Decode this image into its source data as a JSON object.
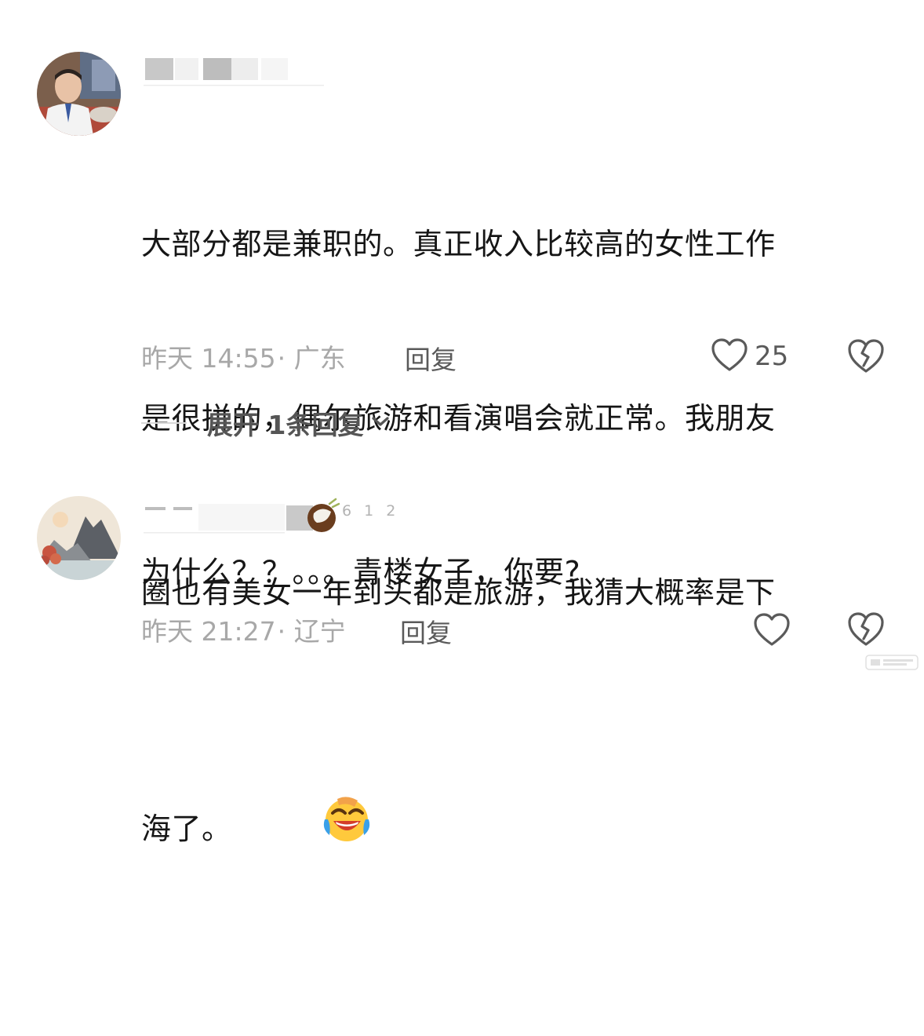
{
  "comments": [
    {
      "text_lines": [
        "大部分都是兼职的。真正收入比较高的女性工作",
        "是很拼的，偶尔旅游和看演唱会就正常。我朋友",
        "圈也有美女一年到头都是旅游，我猜大概率是下",
        "海了。"
      ],
      "emoji": "laughing-crying-emoji",
      "time": "昨天 14:55",
      "location": "· 广东",
      "reply_label": "回复",
      "like_count": "25",
      "expand_label": "展开 1条回复"
    },
    {
      "text": "为什么？？。。。青楼女子，你要?",
      "badge_number": "6 1 2",
      "name_prefix": "一 一",
      "time": "昨天 21:27",
      "location": "· 辽宁",
      "reply_label": "回复"
    }
  ],
  "icons": {
    "like": "heart-outline-icon",
    "dislike": "broken-heart-outline-icon",
    "expand": "chevron-down-icon",
    "badge": "coconut-icon"
  },
  "colors": {
    "meta_gray": "#a8a8a8",
    "action_gray": "#5a5a5a",
    "text": "#161616"
  }
}
